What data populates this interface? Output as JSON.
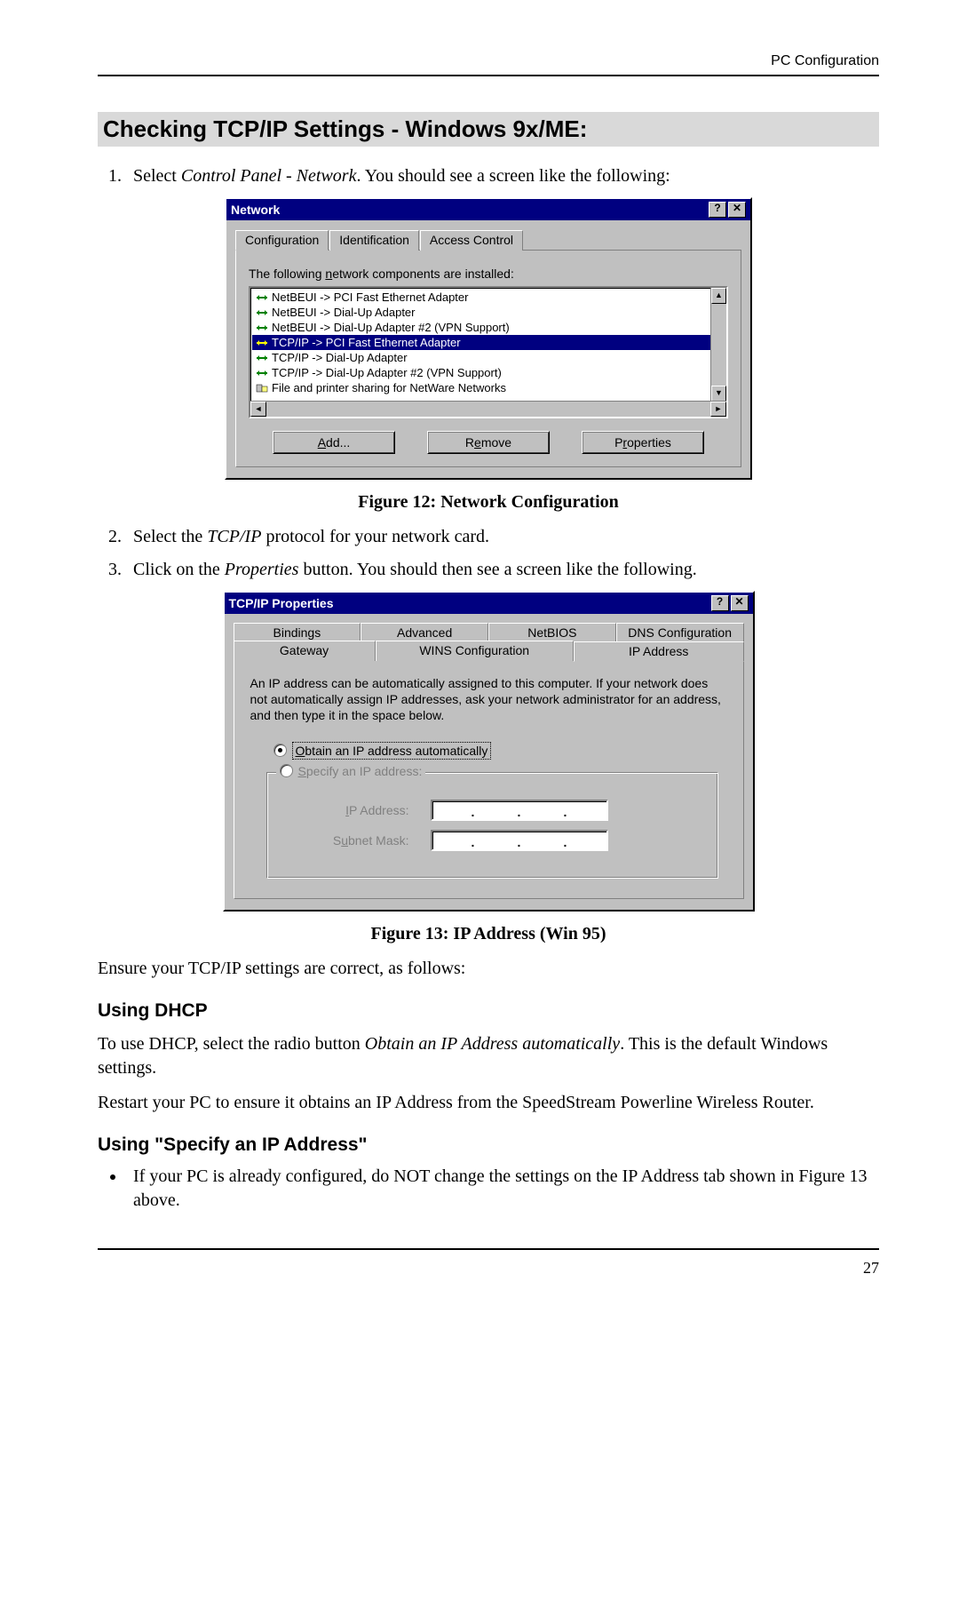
{
  "header": {
    "section": "PC Configuration"
  },
  "title": "Checking TCP/IP Settings - Windows 9x/ME:",
  "step1": {
    "num": "1.",
    "pre": "Select ",
    "em": "Control Panel - Network",
    "post": ". You should see a screen like the following:"
  },
  "fig12": {
    "window_title": "Network",
    "tabs": [
      "Configuration",
      "Identification",
      "Access Control"
    ],
    "list_label_pre": "The following ",
    "list_label_u": "n",
    "list_label_post": "etwork components are installed:",
    "items": [
      "NetBEUI -> PCI Fast Ethernet Adapter",
      "NetBEUI -> Dial-Up Adapter",
      "NetBEUI -> Dial-Up Adapter #2 (VPN Support)",
      "TCP/IP -> PCI Fast Ethernet Adapter",
      "TCP/IP -> Dial-Up Adapter",
      "TCP/IP -> Dial-Up Adapter #2 (VPN Support)",
      "File and printer sharing for NetWare Networks"
    ],
    "selected_index": 3,
    "buttons": {
      "add": "Add...",
      "remove": "Remove",
      "properties": "Properties"
    },
    "caption": "Figure 12: Network Configuration"
  },
  "step2": {
    "num": "2.",
    "pre": "Select the ",
    "em": "TCP/IP",
    "post": " protocol for your network card."
  },
  "step3": {
    "num": "3.",
    "pre": "Click on the ",
    "em": "Properties",
    "post": " button. You should then see a screen like the following."
  },
  "fig13": {
    "window_title": "TCP/IP Properties",
    "tabs_top": [
      "Bindings",
      "Advanced",
      "NetBIOS",
      "DNS Configuration"
    ],
    "tabs_bot": [
      "Gateway",
      "WINS Configuration",
      "IP Address"
    ],
    "active_tab": "IP Address",
    "desc": "An IP address can be automatically assigned to this computer. If your network does not automatically assign IP addresses, ask your network administrator for an address, and then type it in the space below.",
    "radio1_u": "O",
    "radio1_rest": "btain an IP address automatically",
    "radio2_u": "S",
    "radio2_rest": "pecify an IP address:",
    "ip_label_u": "I",
    "ip_label_rest": "P Address:",
    "sub_label_pre": "S",
    "sub_label_u": "u",
    "sub_label_rest": "bnet Mask:",
    "caption": "Figure 13:  IP Address (Win 95)"
  },
  "ensure": "Ensure your TCP/IP settings are correct, as follows:",
  "dhcp": {
    "title": "Using DHCP",
    "p1_pre": "To use DHCP, select the radio button ",
    "p1_em": "Obtain an IP Address automatically",
    "p1_post": ". This is the default Windows settings.",
    "p2": "Restart your PC to ensure it obtains an IP Address from the SpeedStream Powerline Wireless Router."
  },
  "specify": {
    "title": "Using \"Specify an IP Address\"",
    "bullet": "If your PC is already configured, do NOT change the settings on the IP Address tab shown in Figure 13 above."
  },
  "page_number": "27"
}
